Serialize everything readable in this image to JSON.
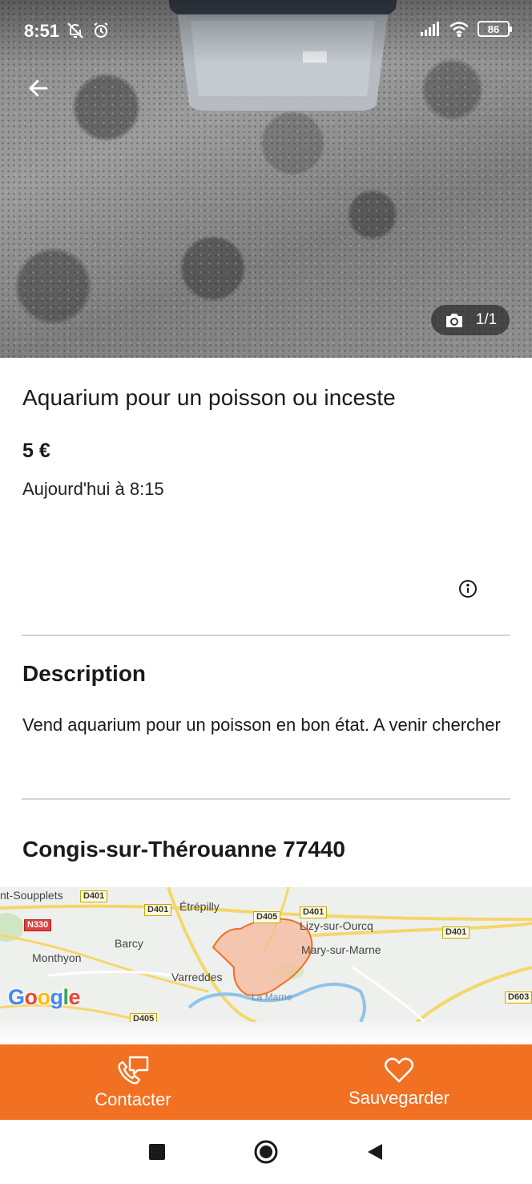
{
  "status_bar": {
    "time": "8:51",
    "battery": "86"
  },
  "gallery": {
    "counter": "1/1"
  },
  "listing": {
    "title": "Aquarium pour un poisson ou inceste",
    "price": "5 €",
    "date": "Aujourd'hui à 8:15"
  },
  "description": {
    "heading": "Description",
    "text": "Vend aquarium pour un poisson en bon état. A venir chercher"
  },
  "location": {
    "heading": "Congis-sur-Thérouanne 77440"
  },
  "map": {
    "places": [
      {
        "name": "nt-Soupplets"
      },
      {
        "name": "Étrépilly"
      },
      {
        "name": "Lizy-sur-Ourcq"
      },
      {
        "name": "Barcy"
      },
      {
        "name": "Monthyon"
      },
      {
        "name": "Mary-sur-Marne"
      },
      {
        "name": "Varreddes"
      },
      {
        "name": "La Marne"
      }
    ],
    "roads": [
      "D401",
      "D401",
      "D405",
      "D401",
      "N330",
      "D401",
      "D603",
      "D405"
    ],
    "logo": "Google",
    "highlight_color": "#f27022"
  },
  "actions": {
    "contact_label": "Contacter",
    "save_label": "Sauvegarder"
  },
  "colors": {
    "accent": "#f27022",
    "divider": "#d5d5d5"
  }
}
